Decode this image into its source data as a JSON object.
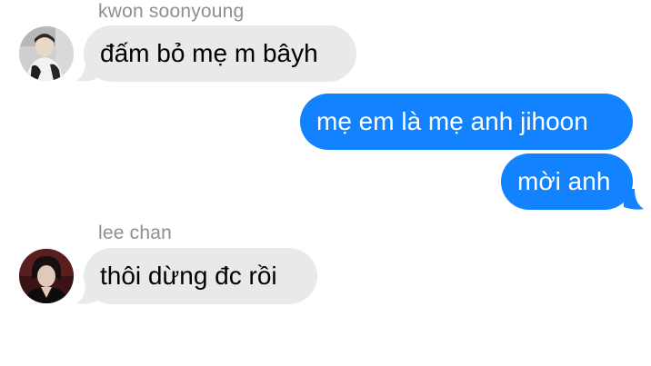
{
  "messages": [
    {
      "sender": "kwon soonyoung",
      "direction": "incoming",
      "text": "đấm bỏ mẹ m bâyh",
      "avatar_icon": "avatar-kwon-soonyoung"
    },
    {
      "direction": "outgoing",
      "text": "mẹ em là mẹ anh jihoon"
    },
    {
      "direction": "outgoing",
      "text": "mời anh"
    },
    {
      "sender": "lee chan",
      "direction": "incoming",
      "text": "thôi dừng đc rồi",
      "avatar_icon": "avatar-lee-chan"
    }
  ],
  "colors": {
    "incoming_bubble": "#e9e9eb",
    "outgoing_bubble": "#1382fe",
    "sender_label": "#8e8e93"
  }
}
